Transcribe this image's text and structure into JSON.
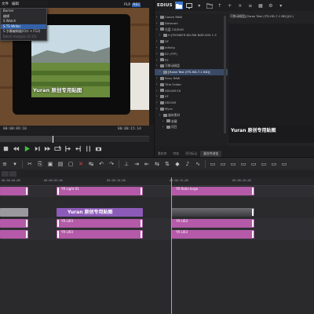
{
  "colors": {
    "accent_blue": "#3a78d0",
    "menu_selected": "#3462a8",
    "clip_pink": "#b45aa8",
    "clip_violet": "#8c5bb8",
    "playhead": "#e6a020"
  },
  "menubar": {
    "items": [
      "文件",
      "编辑"
    ]
  },
  "menu": {
    "items": [
      {
        "label": "Burner",
        "state": "normal"
      },
      {
        "label": "编辑",
        "state": "normal"
      },
      {
        "label": "S Watch",
        "state": "normal"
      },
      {
        "label": "S TS Writer",
        "state": "selected"
      },
      {
        "label": "S 字幕编辑器(Ctrl + F12)",
        "state": "normal"
      },
      {
        "label": "Batch Analysis (0.15)",
        "state": "dim"
      }
    ]
  },
  "player": {
    "plr_label": "PLR",
    "rec_label": "REC",
    "preview_caption": "Yuran 原创专用贴图",
    "timecode_left": "00:00:09:10",
    "timecode_right": "00:00:15:14",
    "scrub_progress": 0.35,
    "transport_icons": [
      "stop-icon",
      "rewind-icon",
      "play-icon",
      "fast-forward-icon",
      "loop-icon",
      "mark-in-icon",
      "mark-out-icon",
      "split-icon",
      "camera-icon"
    ]
  },
  "right_panel": {
    "logo": "EDIUS",
    "path": "可移动磁盘\\[Yuran Test (ITS-HD-7.1 BD)](G:)",
    "folder_tree": [
      {
        "label": "Canon RAW",
        "depth": 1
      },
      {
        "label": "Dataram",
        "depth": 1
      },
      {
        "label": "光盘 CD/DVD",
        "depth": 1
      },
      {
        "label": "H [PIONEER BD-RW   BDR-S09 1.3",
        "depth": 2
      },
      {
        "label": "GF",
        "depth": 1
      },
      {
        "label": "Infinity",
        "depth": 1
      },
      {
        "label": "K2 (FTP)",
        "depth": 1
      },
      {
        "label": "P2",
        "depth": 1
      },
      {
        "label": "可移动磁盘",
        "depth": 1
      },
      {
        "label": "[Yuran Test (ITS-HD-7.1 BD)]",
        "depth": 2,
        "selected": true
      },
      {
        "label": "Sony RAW",
        "depth": 1
      },
      {
        "label": "Title Folder",
        "depth": 1
      },
      {
        "label": "XDCAM EX",
        "depth": 1
      },
      {
        "label": "XF",
        "depth": 1
      },
      {
        "label": "XDCAM",
        "depth": 1
      },
      {
        "label": "Mync",
        "depth": 1
      },
      {
        "label": "媒体素材",
        "depth": 2
      },
      {
        "label": "收藏",
        "depth": 3
      },
      {
        "label": "项目",
        "depth": 3
      }
    ],
    "clip_caption": "Yuran 原创专用贴图",
    "tabs": [
      {
        "label": "素材库",
        "active": false
      },
      {
        "label": "特效",
        "active": false
      },
      {
        "label": "序列标记",
        "active": false
      },
      {
        "label": "源文件浏览",
        "active": true
      }
    ]
  },
  "timeline": {
    "ruler_ticks": [
      "00:00:00;00",
      "00:00:05;00",
      "00:00:10;00",
      "00:00:15;00",
      "00:00:20;00"
    ],
    "tracks": [
      {
        "name": "1VA",
        "clips": [
          {
            "label": "",
            "color": "pink",
            "kind": "small"
          },
          {
            "label": "YR Light 01",
            "color": "pink",
            "kind": "small"
          },
          {
            "label": "YR Ratio large",
            "color": "pink",
            "kind": "small"
          }
        ]
      },
      {
        "name": "1T",
        "clips": [
          {
            "label": "Yuran 原创专用贴图",
            "color": "violet",
            "kind": "big"
          }
        ]
      },
      {
        "name": "2V",
        "clips": [
          {
            "label": "",
            "color": "pink",
            "kind": "small"
          },
          {
            "label": "YR LI03",
            "color": "pink",
            "kind": "small"
          },
          {
            "label": "YR LI03",
            "color": "pink",
            "kind": "small"
          }
        ]
      },
      {
        "name": "3V",
        "clips": [
          {
            "label": "",
            "color": "pink",
            "kind": "small"
          },
          {
            "label": "YR LI03",
            "color": "pink",
            "kind": "small"
          },
          {
            "label": "YR LI03",
            "color": "pink",
            "kind": "small"
          }
        ]
      }
    ]
  }
}
